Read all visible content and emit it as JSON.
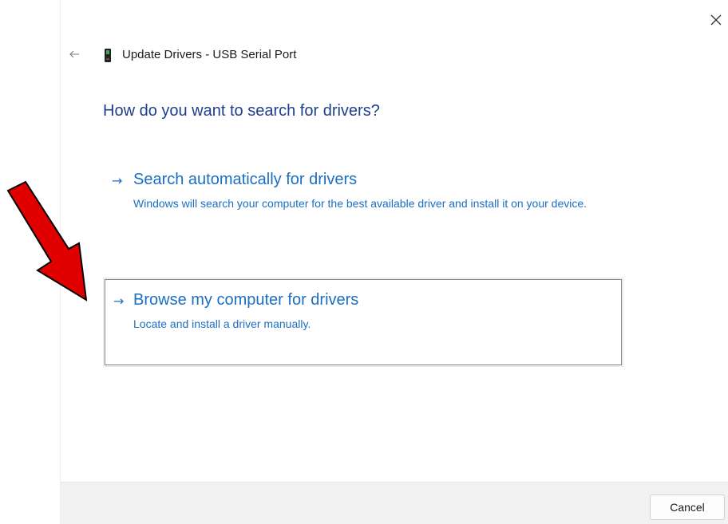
{
  "window": {
    "title": "Update Drivers - USB Serial Port",
    "device_icon": "usb-device-icon",
    "back_icon": "back-arrow-icon",
    "close_icon": "close-icon"
  },
  "main": {
    "question": "How do you want to search for drivers?",
    "options": [
      {
        "title": "Search automatically for drivers",
        "description": "Windows will search your computer for the best available driver and install it on your device.",
        "icon": "arrow-right-icon"
      },
      {
        "title": "Browse my computer for drivers",
        "description": "Locate and install a driver manually.",
        "icon": "arrow-right-icon",
        "highlighted": true
      }
    ]
  },
  "annotation": {
    "icon": "red-pointer-arrow",
    "color": "#e00000"
  },
  "footer": {
    "cancel_label": "Cancel"
  },
  "colors": {
    "link": "#1b6fc2",
    "heading": "#1e3d8f",
    "footer_bg": "#f2f2f2"
  }
}
